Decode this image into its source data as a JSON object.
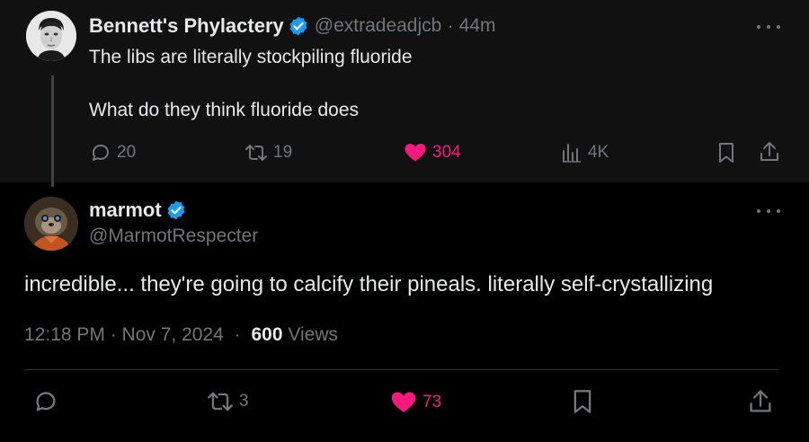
{
  "parent_tweet": {
    "display_name": "Bennett's Phylactery",
    "handle": "@extradeadjcb",
    "separator": "·",
    "time_ago": "44m",
    "text_line1": "The libs are literally stockpiling fluoride",
    "text_line2": "What do they think fluoride does",
    "stats": {
      "replies": "20",
      "retweets": "19",
      "likes": "304",
      "views": "4K"
    }
  },
  "reply_tweet": {
    "display_name": "marmot",
    "handle": "@MarmotRespecter",
    "text": "incredible... they're going to calcify their pineals. literally self-crystallizing",
    "timestamp": "12:18 PM · Nov 7, 2024",
    "meta_separator": "·",
    "views_count": "600",
    "views_label": "Views",
    "stats": {
      "retweets": "3",
      "likes": "73"
    }
  },
  "colors": {
    "background": "#000000",
    "parent_background": "#111111",
    "text": "#e7e9ea",
    "muted": "#71767b",
    "like": "#f91880",
    "verified": "#1d9bf0"
  },
  "icons": [
    "verified-badge-icon",
    "more-icon",
    "reply-icon",
    "retweet-icon",
    "heart-icon",
    "views-icon",
    "bookmark-icon",
    "share-icon"
  ]
}
